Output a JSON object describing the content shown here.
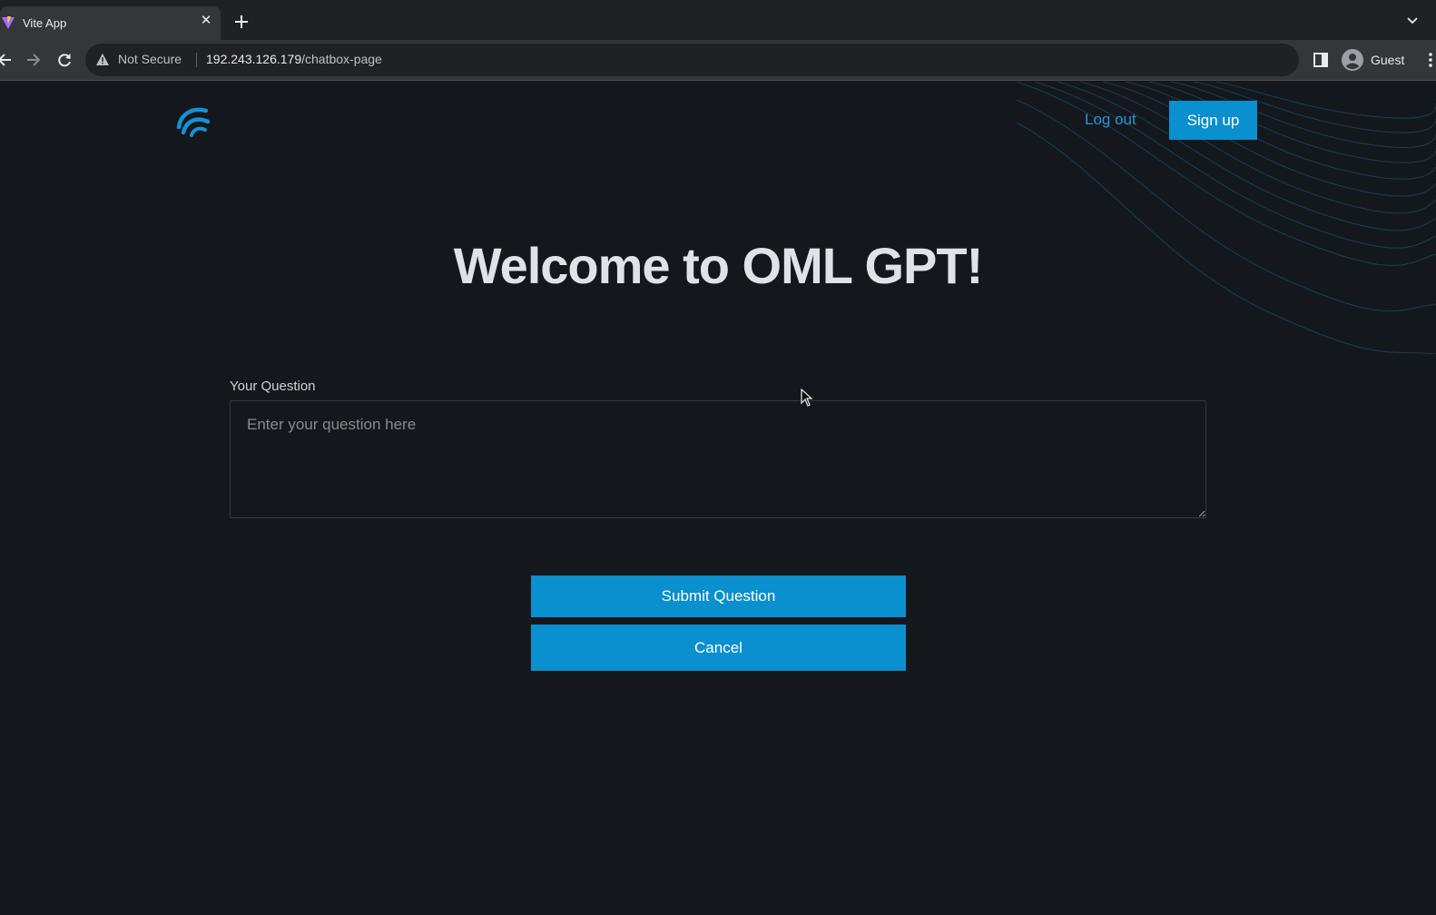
{
  "browser": {
    "tab_title": "Vite App",
    "security_label": "Not Secure",
    "url_host": "192.243.126.179",
    "url_path": "/chatbox-page",
    "profile_label": "Guest"
  },
  "header": {
    "logout_label": "Log out",
    "signup_label": "Sign up"
  },
  "main": {
    "title": "Welcome to OML GPT!",
    "question_label": "Your Question",
    "question_placeholder": "Enter your question here",
    "question_value": "",
    "submit_label": "Submit Question",
    "cancel_label": "Cancel"
  },
  "colors": {
    "accent": "#0a8fcf",
    "background": "#14181c",
    "link": "#2a95d1"
  }
}
